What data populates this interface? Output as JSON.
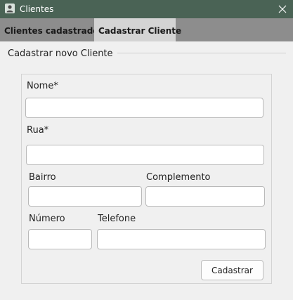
{
  "window": {
    "title": "Clientes",
    "icon": "user-icon",
    "close": "close-icon"
  },
  "tabs": [
    {
      "label": "Clientes cadastrados",
      "active": false
    },
    {
      "label": "Cadastrar Cliente",
      "active": true
    }
  ],
  "form": {
    "section_title": "Cadastrar novo Cliente",
    "fields": {
      "nome": {
        "label": "Nome*",
        "value": ""
      },
      "rua": {
        "label": "Rua*",
        "value": ""
      },
      "bairro": {
        "label": "Bairro",
        "value": ""
      },
      "complemento": {
        "label": "Complemento",
        "value": ""
      },
      "numero": {
        "label": "Número",
        "value": ""
      },
      "telefone": {
        "label": "Telefone",
        "value": ""
      }
    },
    "submit_label": "Cadastrar"
  },
  "colors": {
    "titlebar": "#4a6355",
    "tabbar": "#8d8d8d",
    "active_tab": "#d4d4d4",
    "background": "#f0f0f0"
  }
}
